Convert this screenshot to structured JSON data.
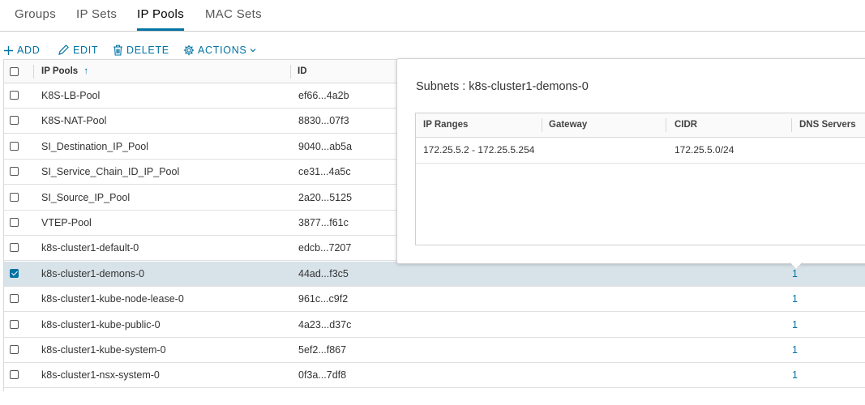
{
  "tabs": [
    "Groups",
    "IP Sets",
    "IP Pools",
    "MAC Sets"
  ],
  "active_tab": "IP Pools",
  "toolbar": {
    "add_label": "ADD",
    "edit_label": "EDIT",
    "delete_label": "DELETE",
    "actions_label": "ACTIONS"
  },
  "table": {
    "columns": [
      "IP Pools",
      "ID"
    ],
    "sort_indicator": "↑",
    "rows": [
      {
        "name": "K8S-LB-Pool",
        "id": "ef66...4a2b",
        "subnets": "",
        "selected": false
      },
      {
        "name": "K8S-NAT-Pool",
        "id": "8830...07f3",
        "subnets": "",
        "selected": false
      },
      {
        "name": "SI_Destination_IP_Pool",
        "id": "9040...ab5a",
        "subnets": "",
        "selected": false
      },
      {
        "name": "SI_Service_Chain_ID_IP_Pool",
        "id": "ce31...4a5c",
        "subnets": "",
        "selected": false
      },
      {
        "name": "SI_Source_IP_Pool",
        "id": "2a20...5125",
        "subnets": "",
        "selected": false
      },
      {
        "name": "VTEP-Pool",
        "id": "3877...f61c",
        "subnets": "",
        "selected": false
      },
      {
        "name": "k8s-cluster1-default-0",
        "id": "edcb...7207",
        "subnets": "",
        "selected": false
      },
      {
        "name": "k8s-cluster1-demons-0",
        "id": "44ad...f3c5",
        "subnets": "1",
        "selected": true
      },
      {
        "name": "k8s-cluster1-kube-node-lease-0",
        "id": "961c...c9f2",
        "subnets": "1",
        "selected": false
      },
      {
        "name": "k8s-cluster1-kube-public-0",
        "id": "4a23...d37c",
        "subnets": "1",
        "selected": false
      },
      {
        "name": "k8s-cluster1-kube-system-0",
        "id": "5ef2...f867",
        "subnets": "1",
        "selected": false
      },
      {
        "name": "k8s-cluster1-nsx-system-0",
        "id": "0f3a...7df8",
        "subnets": "1",
        "selected": false
      }
    ]
  },
  "popover": {
    "title": "Subnets : k8s-cluster1-demons-0",
    "columns": [
      "IP Ranges",
      "Gateway",
      "CIDR",
      "DNS Servers"
    ],
    "rows": [
      {
        "ip_ranges": "172.25.5.2 - 172.25.5.254",
        "gateway": "",
        "cidr": "172.25.5.0/24",
        "dns_servers": ""
      }
    ]
  },
  "colors": {
    "accent": "#0072a3",
    "selected_row": "#d8e3e9"
  },
  "icons": [
    "plus-icon",
    "pencil-icon",
    "trash-icon",
    "gear-icon",
    "chevron-down-icon",
    "sort-up-icon",
    "checkbox-icon"
  ]
}
